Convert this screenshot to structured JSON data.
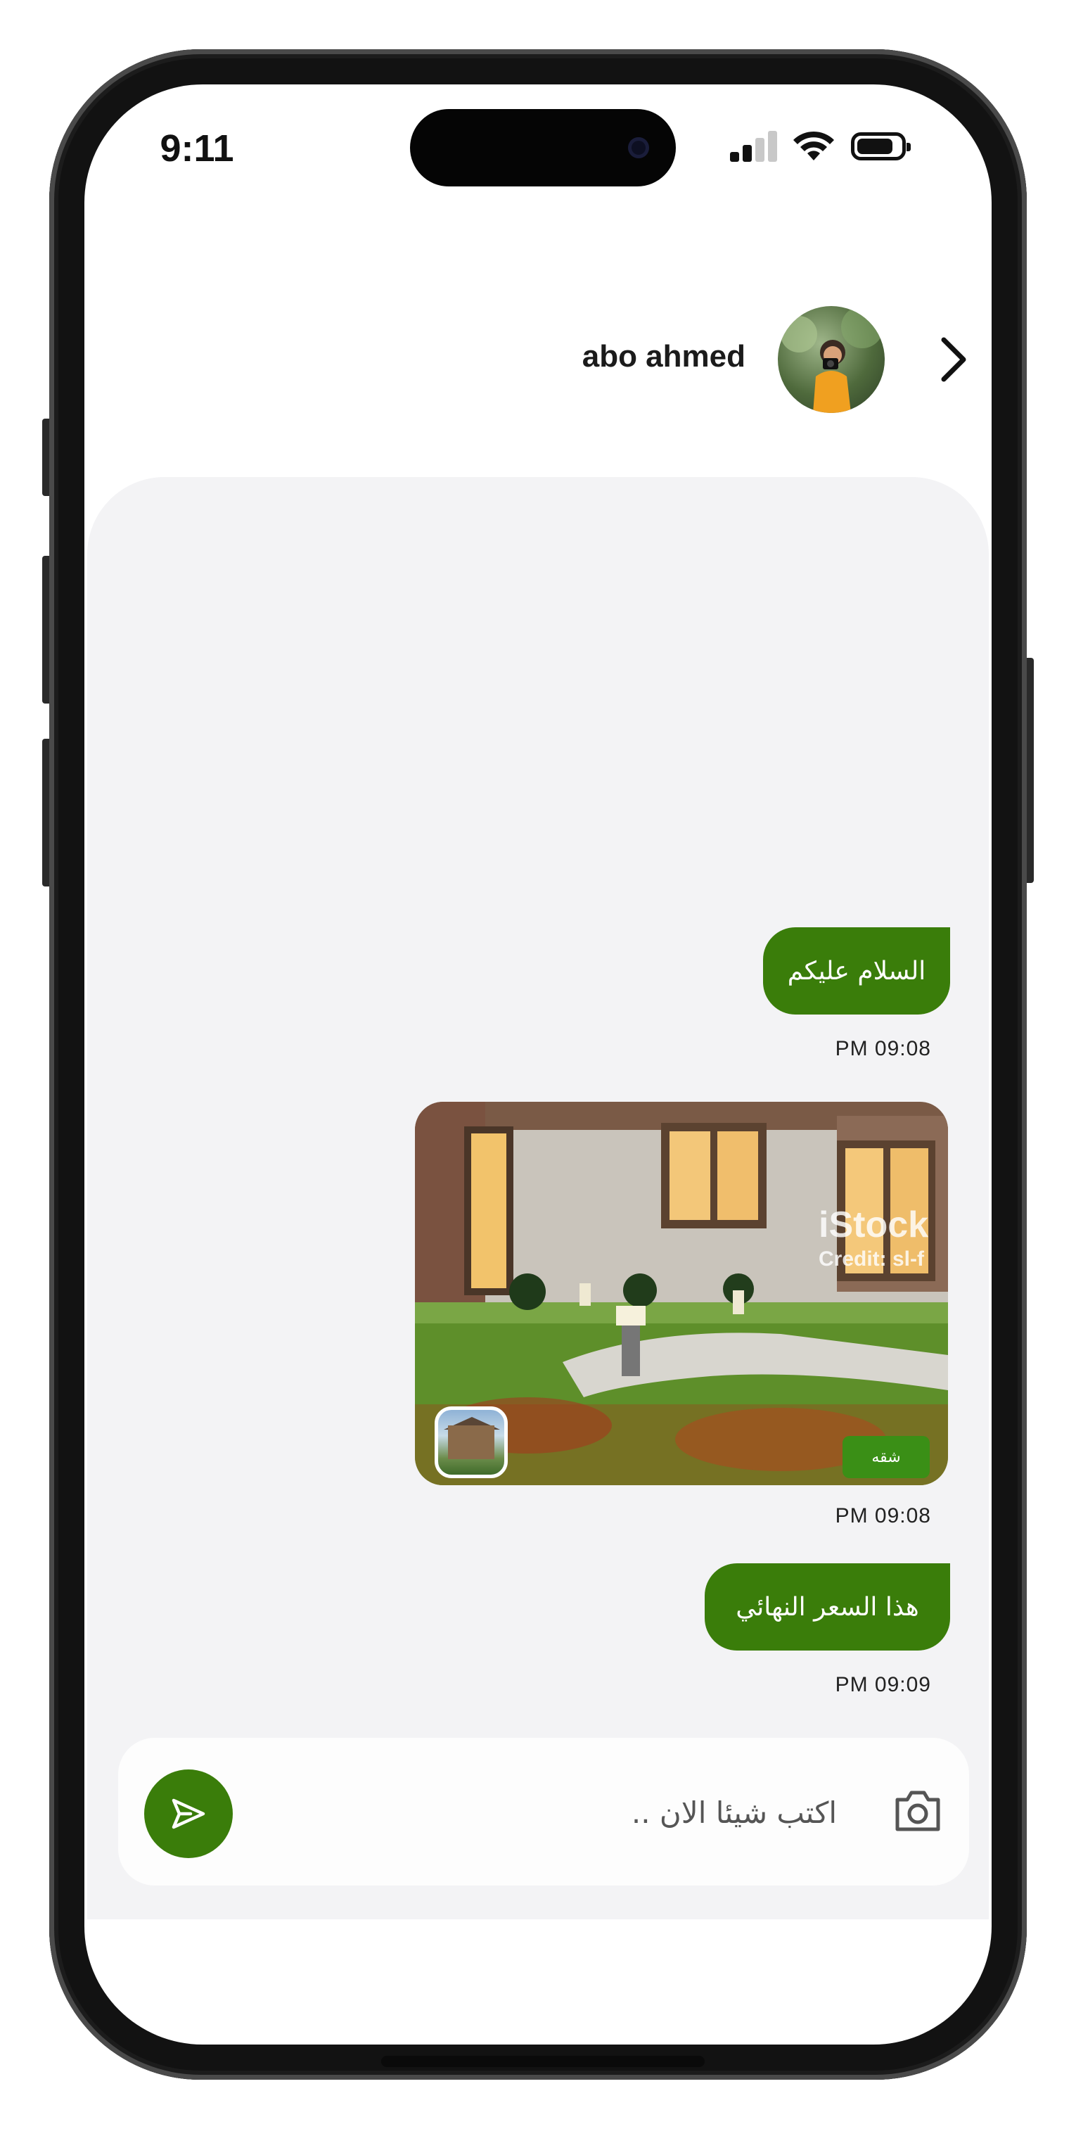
{
  "status_bar": {
    "time": "9:11"
  },
  "header": {
    "contact_name": "abo ahmed",
    "avatar_icon": "person-avatar",
    "back_icon": "chevron-right-icon"
  },
  "messages": [
    {
      "type": "text",
      "text": "السلام عليكم",
      "time": "PM 09:08"
    },
    {
      "type": "image",
      "watermark_line1": "iStock",
      "watermark_line2": "Credit: sl-f",
      "tag": "شقه",
      "time": "PM 09:08"
    },
    {
      "type": "text",
      "text": "هذا السعر النهائي",
      "time": "PM 09:09"
    }
  ],
  "composer": {
    "placeholder": "اكتب شيئا الان ..",
    "send_icon": "send-icon",
    "camera_icon": "camera-icon"
  },
  "colors": {
    "accent": "#3a7d0a",
    "chat_background": "#f3f3f5",
    "tag_background": "#3a8f16"
  }
}
